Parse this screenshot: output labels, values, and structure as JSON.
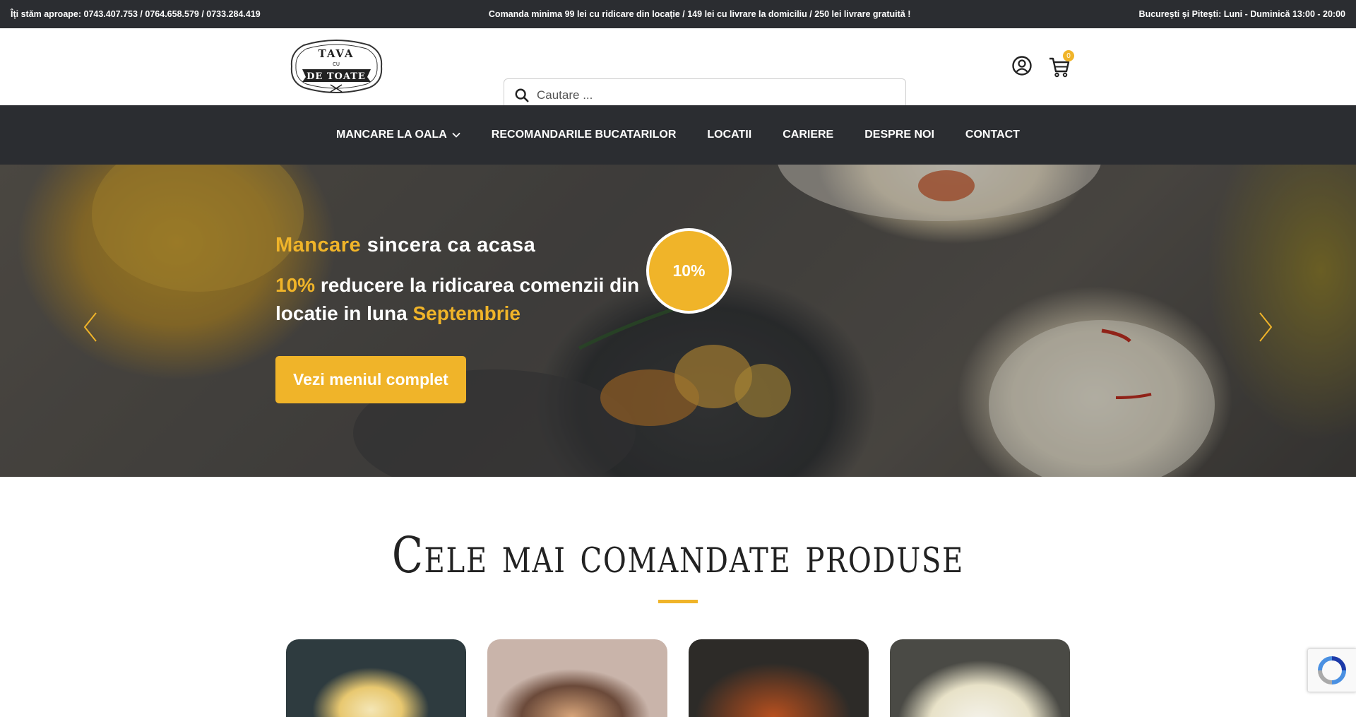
{
  "topbar": {
    "phone": "Îți stăm aproape: 0743.407.753 / 0764.658.579 / 0733.284.419",
    "order_info": "Comanda minima 99 lei cu ridicare din locație / 149 lei cu livrare la domiciliu / 250 lei livrare gratuită !",
    "hours": "București și Pitești: Luni - Duminică 13:00 - 20:00"
  },
  "logo": {
    "line1": "TAVA",
    "line2": "CU",
    "line3": "DE TOATE"
  },
  "search": {
    "placeholder": "Cautare ..."
  },
  "cart": {
    "count": "0"
  },
  "nav": {
    "items": [
      {
        "label": "MANCARE LA OALA"
      },
      {
        "label": "RECOMANDARILE BUCATARILOR"
      },
      {
        "label": "LOCATII"
      },
      {
        "label": "CARIERE"
      },
      {
        "label": "DESPRE NOI"
      },
      {
        "label": "CONTACT"
      }
    ]
  },
  "hero": {
    "title_highlight": "Mancare",
    "title_rest": " sincera ca acasa",
    "sub_highlight": "10%",
    "sub_rest": " reducere la ridicarea comenzii din locatie in luna ",
    "sub_month": "Septembrie",
    "cta": "Vezi meniul complet",
    "badge": "10%"
  },
  "section": {
    "title": "Cele mai comandate produse"
  },
  "colors": {
    "accent": "#f0b429",
    "dark": "#2b2d31"
  }
}
